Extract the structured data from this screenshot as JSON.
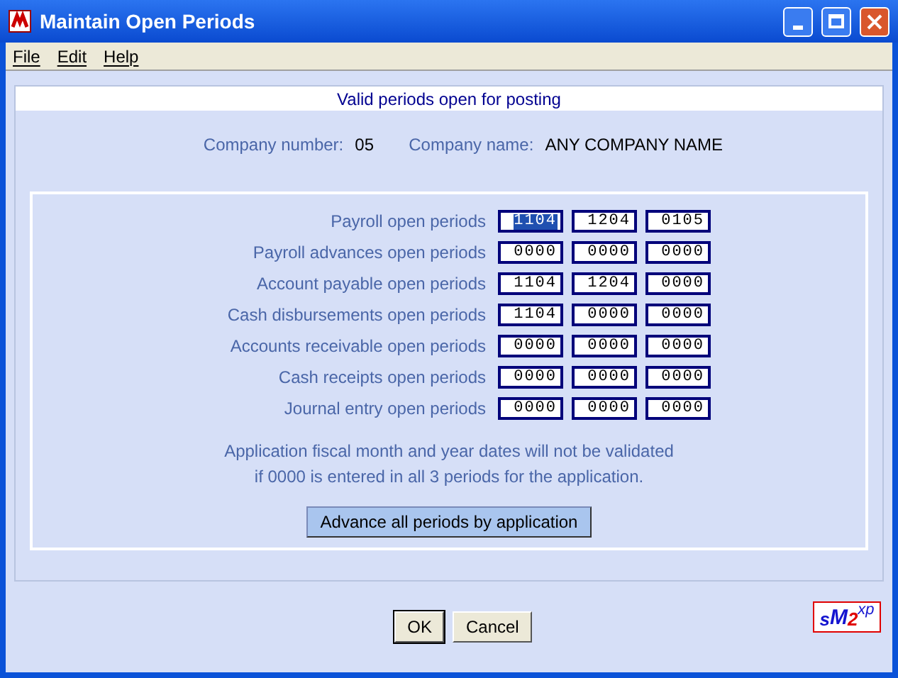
{
  "window": {
    "title": "Maintain Open Periods"
  },
  "menu": [
    "File",
    "Edit",
    "Help"
  ],
  "header": "Valid periods open for posting",
  "company": {
    "number_label": "Company number:",
    "number": "05",
    "name_label": "Company name:",
    "name": "ANY COMPANY NAME"
  },
  "rows": [
    {
      "label": "Payroll open periods",
      "periods": [
        {
          "value": "1104",
          "selected": true
        },
        {
          "value": "1204",
          "selected": false
        },
        {
          "value": "0105",
          "selected": false
        }
      ]
    },
    {
      "label": "Payroll advances open periods",
      "periods": [
        {
          "value": "0000",
          "selected": false
        },
        {
          "value": "0000",
          "selected": false
        },
        {
          "value": "0000",
          "selected": false
        }
      ]
    },
    {
      "label": "Account payable open periods",
      "periods": [
        {
          "value": "1104",
          "selected": false
        },
        {
          "value": "1204",
          "selected": false
        },
        {
          "value": "0000",
          "selected": false
        }
      ]
    },
    {
      "label": "Cash disbursements open periods",
      "periods": [
        {
          "value": "1104",
          "selected": false
        },
        {
          "value": "0000",
          "selected": false
        },
        {
          "value": "0000",
          "selected": false
        }
      ]
    },
    {
      "label": "Accounts receivable open periods",
      "periods": [
        {
          "value": "0000",
          "selected": false
        },
        {
          "value": "0000",
          "selected": false
        },
        {
          "value": "0000",
          "selected": false
        }
      ]
    },
    {
      "label": "Cash receipts open periods",
      "periods": [
        {
          "value": "0000",
          "selected": false
        },
        {
          "value": "0000",
          "selected": false
        },
        {
          "value": "0000",
          "selected": false
        }
      ]
    },
    {
      "label": "Journal entry open periods",
      "periods": [
        {
          "value": "0000",
          "selected": false
        },
        {
          "value": "0000",
          "selected": false
        },
        {
          "value": "0000",
          "selected": false
        }
      ]
    }
  ],
  "note": [
    "Application fiscal month and year dates will not be validated",
    "if 0000 is entered in all 3 periods for the application."
  ],
  "advance_button": "Advance all periods by application",
  "buttons": [
    "OK",
    "Cancel"
  ],
  "logo": {
    "s": "s",
    "m": "M",
    "two": "2",
    "xp": "xp"
  }
}
